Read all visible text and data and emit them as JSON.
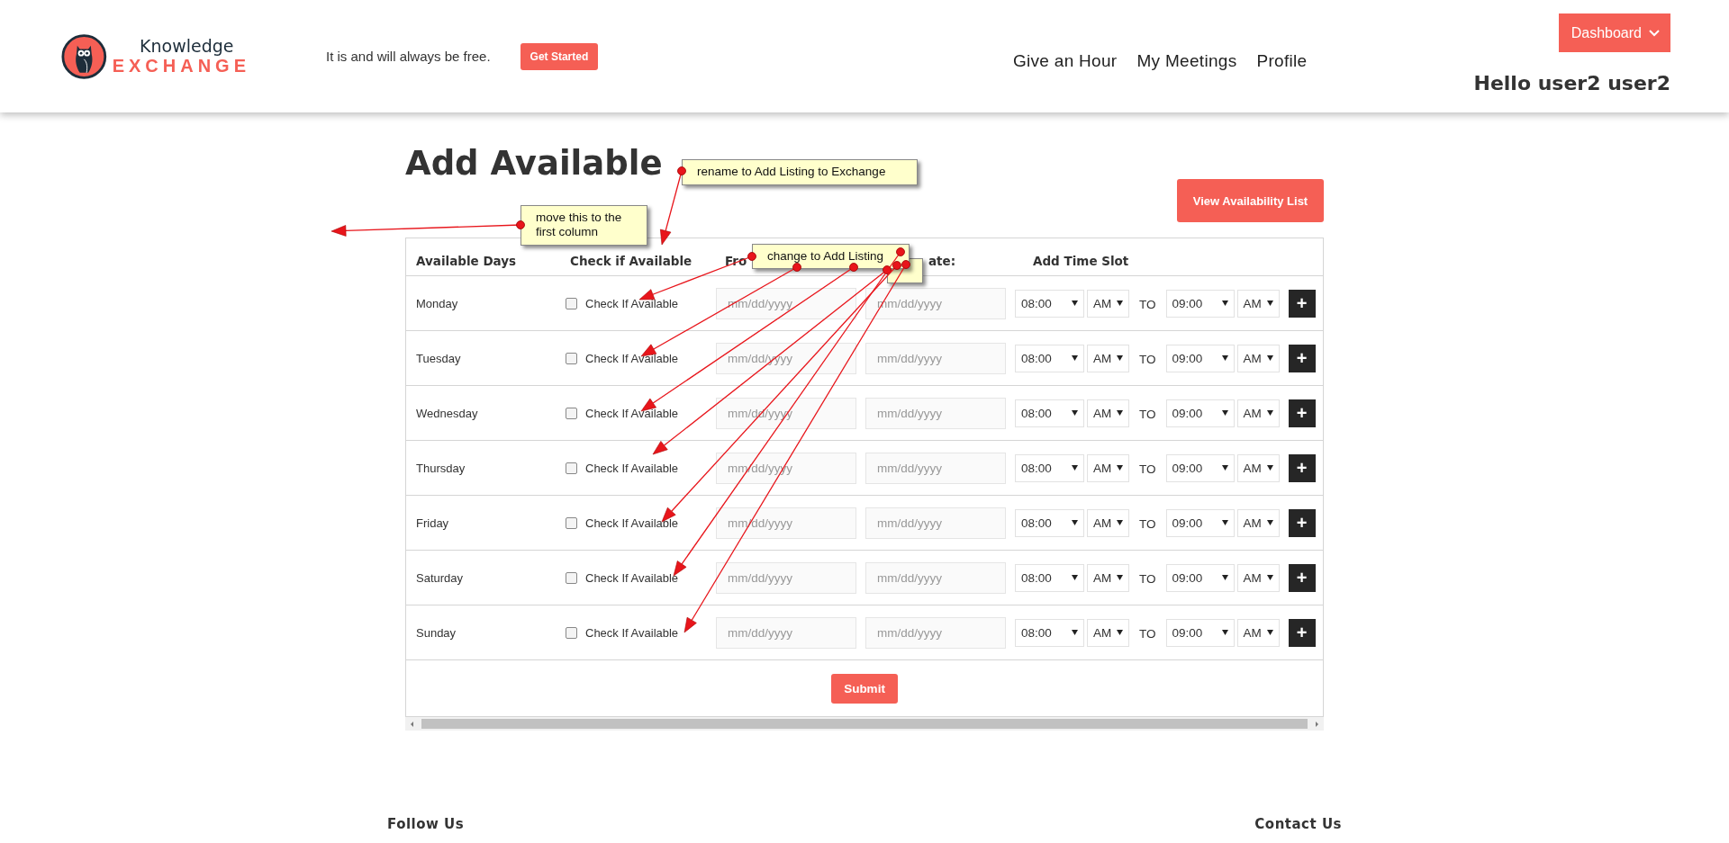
{
  "header": {
    "logo_top": "Knowledge",
    "logo_bottom": "EXCHANGE",
    "tagline": "It is and will always be free.",
    "cta": "Get Started",
    "nav": [
      {
        "label": "Give an Hour"
      },
      {
        "label": "My Meetings"
      },
      {
        "label": "Profile"
      }
    ],
    "menu_button": "Dashboard",
    "greeting": "Hello user2 user2"
  },
  "page": {
    "title": "Add Available",
    "view_button": "View Availability List"
  },
  "table": {
    "columns": [
      "Available Days",
      "Check if Available",
      "Fro",
      "ate:",
      "Add Time Slot"
    ],
    "rows": [
      {
        "day": "Monday",
        "checked": false,
        "check_label": "Check If Available",
        "from_placeholder": "mm/dd/yyyy",
        "to_placeholder": "mm/dd/yyyy",
        "start_time": "08:00",
        "start_period": "AM",
        "separator": "TO",
        "end_time": "09:00",
        "end_period": "AM",
        "add": "+"
      },
      {
        "day": "Tuesday",
        "checked": false,
        "check_label": "Check If Available",
        "from_placeholder": "mm/dd/yyyy",
        "to_placeholder": "mm/dd/yyyy",
        "start_time": "08:00",
        "start_period": "AM",
        "separator": "TO",
        "end_time": "09:00",
        "end_period": "AM",
        "add": "+"
      },
      {
        "day": "Wednesday",
        "checked": false,
        "check_label": "Check If Available",
        "from_placeholder": "mm/dd/yyyy",
        "to_placeholder": "mm/dd/yyyy",
        "start_time": "08:00",
        "start_period": "AM",
        "separator": "TO",
        "end_time": "09:00",
        "end_period": "AM",
        "add": "+"
      },
      {
        "day": "Thursday",
        "checked": false,
        "check_label": "Check If Available",
        "from_placeholder": "mm/dd/yyyy",
        "to_placeholder": "mm/dd/yyyy",
        "start_time": "08:00",
        "start_period": "AM",
        "separator": "TO",
        "end_time": "09:00",
        "end_period": "AM",
        "add": "+"
      },
      {
        "day": "Friday",
        "checked": false,
        "check_label": "Check If Available",
        "from_placeholder": "mm/dd/yyyy",
        "to_placeholder": "mm/dd/yyyy",
        "start_time": "08:00",
        "start_period": "AM",
        "separator": "TO",
        "end_time": "09:00",
        "end_period": "AM",
        "add": "+"
      },
      {
        "day": "Saturday",
        "checked": false,
        "check_label": "Check If Available",
        "from_placeholder": "mm/dd/yyyy",
        "to_placeholder": "mm/dd/yyyy",
        "start_time": "08:00",
        "start_period": "AM",
        "separator": "TO",
        "end_time": "09:00",
        "end_period": "AM",
        "add": "+"
      },
      {
        "day": "Sunday",
        "checked": false,
        "check_label": "Check If Available",
        "from_placeholder": "mm/dd/yyyy",
        "to_placeholder": "mm/dd/yyyy",
        "start_time": "08:00",
        "start_period": "AM",
        "separator": "TO",
        "end_time": "09:00",
        "end_period": "AM",
        "add": "+"
      }
    ],
    "submit": "Submit"
  },
  "footer": {
    "headings": [
      "Follow Us",
      "Contact Us"
    ]
  },
  "annotations": [
    {
      "text": "rename to Add Listing to Exchange"
    },
    {
      "text": "move this to the first column"
    },
    {
      "text": "change to Add Listing"
    }
  ]
}
